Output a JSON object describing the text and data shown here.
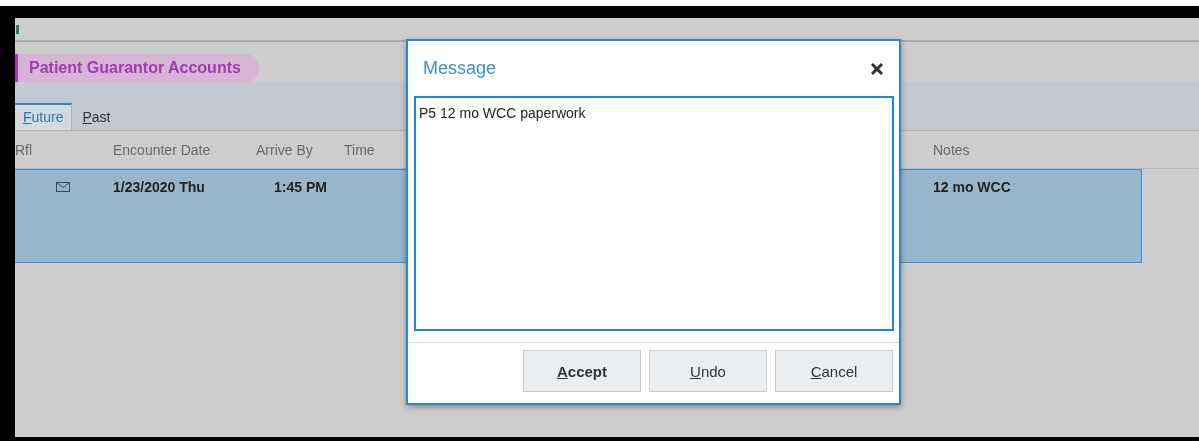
{
  "section": {
    "title": "Patient Guarantor Accounts"
  },
  "tabs": [
    {
      "label": "Future",
      "selected": true
    },
    {
      "label": "Past",
      "selected": false
    }
  ],
  "table": {
    "columns": [
      "Rfl",
      "Encounter Date",
      "Arrive By",
      "Time",
      "Notes"
    ],
    "rows": [
      {
        "selected": true,
        "has_message": true,
        "encounter_date": "1/23/2020 Thu",
        "arrive_by": "1:45 PM",
        "notes": "12 mo WCC"
      }
    ]
  },
  "dialog": {
    "title": "Message",
    "value": "P5 12 mo WCC paperwork",
    "buttons": [
      "Accept",
      "Undo",
      "Cancel"
    ]
  }
}
